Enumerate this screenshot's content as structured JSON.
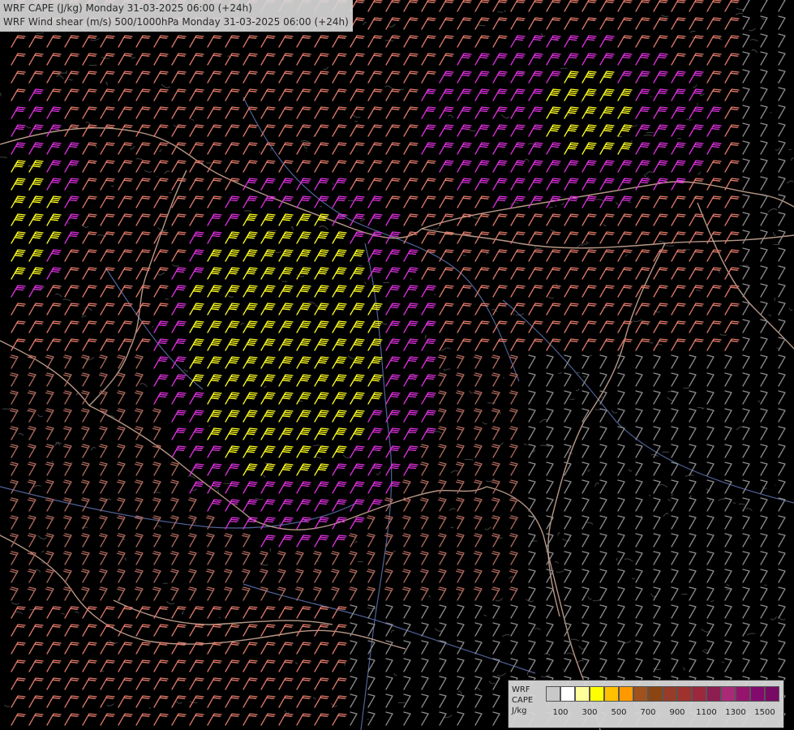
{
  "header": {
    "line1": "WRF CAPE (J/kg) Monday 31-03-2025 06:00 (+24h)",
    "line2": "WRF Wind shear (m/s) 500/1000hPa Monday 31-03-2025 06:00 (+24h)"
  },
  "legend": {
    "title": [
      "WRF",
      "CAPE",
      "J/kg"
    ],
    "colors": [
      "#c8c8c8",
      "#ffffff",
      "#ffff99",
      "#ffff00",
      "#ffc000",
      "#ff9900",
      "#a0521e",
      "#8b4513",
      "#963c28",
      "#a0322d",
      "#9b283c",
      "#8c1e50",
      "#aa2a78",
      "#96146e",
      "#820a6e",
      "#780a64"
    ],
    "tick_labels": [
      "100",
      "300",
      "500",
      "700",
      "900",
      "1100",
      "1300",
      "1500"
    ]
  },
  "barb_colors": {
    "weak": "#8c8c8c",
    "moderate": "#b06a5e",
    "strong": "#e27a6b",
    "very_strong": "#e030e0",
    "extreme": "#ffff20"
  },
  "overlay_colors": {
    "border": "#d7b29e",
    "river": "#5a6ea8",
    "terrain": "#606060"
  }
}
